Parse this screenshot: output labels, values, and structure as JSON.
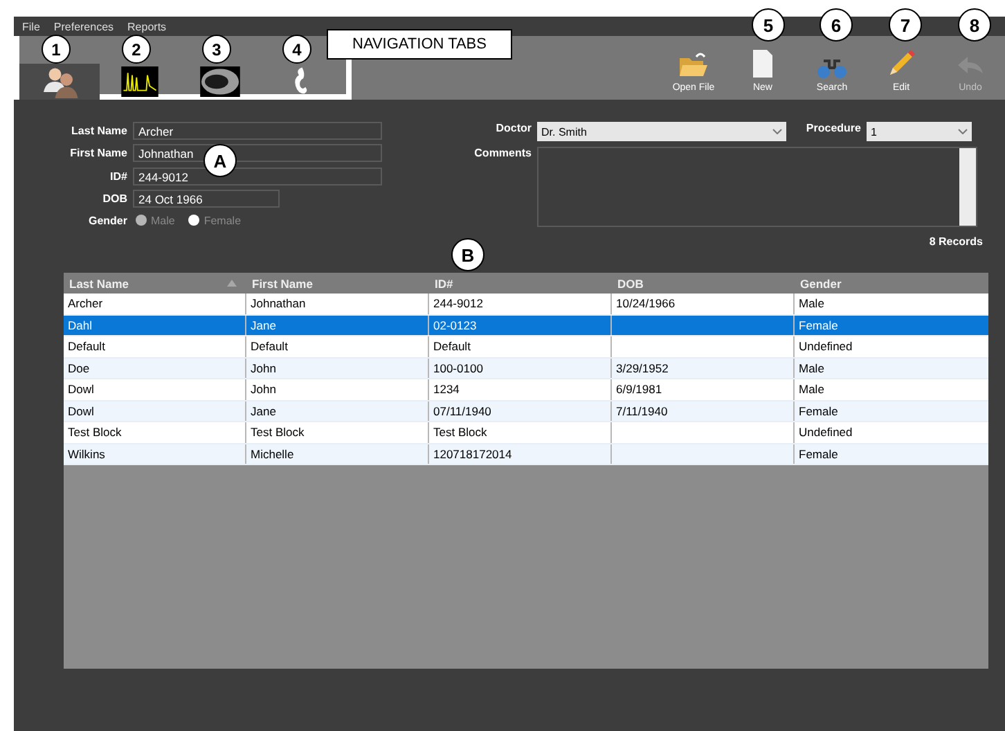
{
  "menu": [
    "File",
    "Preferences",
    "Reports"
  ],
  "nav_tabs": [
    {
      "kind": "patients",
      "selected": true
    },
    {
      "kind": "waveform",
      "selected": false
    },
    {
      "kind": "scan",
      "selected": false
    },
    {
      "kind": "curl",
      "selected": false
    }
  ],
  "nav_annotation": "NAVIGATION TABS",
  "toolbar": [
    {
      "kind": "open",
      "label": "Open File",
      "disabled": false
    },
    {
      "kind": "new",
      "label": "New",
      "disabled": false
    },
    {
      "kind": "search",
      "label": "Search",
      "disabled": false
    },
    {
      "kind": "edit",
      "label": "Edit",
      "disabled": false
    },
    {
      "kind": "undo",
      "label": "Undo",
      "disabled": true
    }
  ],
  "callouts": [
    {
      "kind": "tab",
      "label": "1"
    },
    {
      "kind": "tab",
      "label": "2"
    },
    {
      "kind": "tab",
      "label": "3"
    },
    {
      "kind": "tab",
      "label": "4"
    },
    {
      "kind": "tool",
      "label": "5"
    },
    {
      "kind": "tool",
      "label": "6"
    },
    {
      "kind": "tool",
      "label": "7"
    },
    {
      "kind": "tool",
      "label": "8"
    },
    {
      "kind": "form",
      "label": "A"
    },
    {
      "kind": "table",
      "label": "B"
    }
  ],
  "form": {
    "fields": [
      {
        "label": "Last Name",
        "value": "Archer",
        "wide": true
      },
      {
        "label": "First Name",
        "value": "Johnathan",
        "wide": true
      },
      {
        "label": "ID#",
        "value": "244-9012",
        "wide": true
      },
      {
        "label": "DOB",
        "value": "24 Oct 1966",
        "wide": false
      }
    ],
    "gender": {
      "label": "Gender",
      "options": [
        {
          "label": "Male",
          "selected": true
        },
        {
          "label": "Female",
          "selected": false
        }
      ]
    },
    "doctor": {
      "label": "Doctor",
      "value": "Dr. Smith"
    },
    "procedure": {
      "label": "Procedure",
      "value": "1"
    },
    "comments": {
      "label": "Comments"
    }
  },
  "record_count": "8 Records",
  "table": {
    "columns": [
      {
        "label": "Last Name",
        "sorted": true
      },
      {
        "label": "First Name",
        "sorted": false
      },
      {
        "label": "ID#",
        "sorted": false
      },
      {
        "label": "DOB",
        "sorted": false
      },
      {
        "label": "Gender",
        "sorted": false
      }
    ],
    "rows": [
      {
        "selected": false,
        "cells": [
          "Archer",
          "Johnathan",
          "244-9012",
          "10/24/1966",
          "Male"
        ]
      },
      {
        "selected": true,
        "cells": [
          "Dahl",
          "Jane",
          "02-0123",
          "",
          "Female"
        ]
      },
      {
        "selected": false,
        "cells": [
          "Default",
          "Default",
          "Default",
          "",
          "Undefined"
        ]
      },
      {
        "selected": false,
        "cells": [
          "Doe",
          "John",
          "100-0100",
          "3/29/1952",
          "Male"
        ]
      },
      {
        "selected": false,
        "cells": [
          "Dowl",
          "John",
          "1234",
          "6/9/1981",
          "Male"
        ]
      },
      {
        "selected": false,
        "cells": [
          "Dowl",
          "Jane",
          "07/11/1940",
          "7/11/1940",
          "Female"
        ]
      },
      {
        "selected": false,
        "cells": [
          "Test Block",
          "Test Block",
          "Test Block",
          "",
          "Undefined"
        ]
      },
      {
        "selected": false,
        "cells": [
          "Wilkins",
          "Michelle",
          "120718172014",
          "",
          "Female"
        ]
      }
    ]
  }
}
